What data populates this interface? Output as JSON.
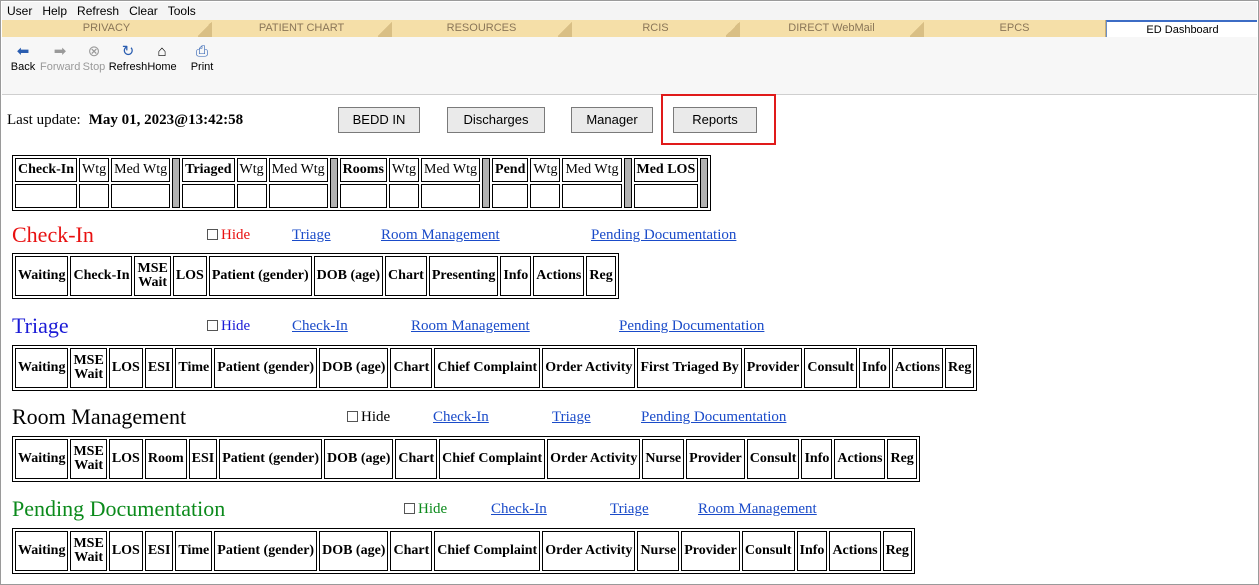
{
  "menu": [
    "User",
    "Help",
    "Refresh",
    "Clear",
    "Tools"
  ],
  "tabs": [
    "PRIVACY",
    "PATIENT CHART",
    "RESOURCES",
    "RCIS",
    "DIRECT WebMail",
    "EPCS",
    "ED Dashboard"
  ],
  "toolbar": {
    "back": "Back",
    "forward": "Forward",
    "stop": "Stop",
    "refresh": "Refresh",
    "home": "Home",
    "print": "Print"
  },
  "update": {
    "label": "Last update:",
    "value": "May 01, 2023@13:42:58"
  },
  "buttons": {
    "bedd_in": "BEDD IN",
    "discharges": "Discharges",
    "manager": "Manager",
    "reports": "Reports"
  },
  "summary": {
    "headers": [
      "Check-In",
      "Wtg",
      "Med Wtg",
      "Triaged",
      "Wtg",
      "Med Wtg",
      "Rooms",
      "Wtg",
      "Med Wtg",
      "Pend",
      "Wtg",
      "Med Wtg",
      "Med LOS"
    ]
  },
  "hide_label": "Hide",
  "sections": {
    "checkin": {
      "title": "Check-In",
      "color": "#e81010",
      "links": [
        "Triage",
        "Room Management",
        "Pending Documentation"
      ],
      "columns": [
        "Waiting",
        "Check-In",
        "MSE",
        "Wait",
        "LOS",
        "Patient (gender)",
        "DOB (age)",
        "Chart",
        "Presenting",
        "Info",
        "Actions",
        "Reg"
      ]
    },
    "triage": {
      "title": "Triage",
      "color": "#1a1ad6",
      "links": [
        "Check-In",
        "Room Management",
        "Pending Documentation"
      ],
      "columns": [
        "Waiting",
        "MSE",
        "Wait",
        "LOS",
        "ESI",
        "Time",
        "Patient (gender)",
        "DOB (age)",
        "Chart",
        "Chief Complaint",
        "Order Activity",
        "First Triaged By",
        "Provider",
        "Consult",
        "Info",
        "Actions",
        "Reg"
      ]
    },
    "room": {
      "title": "Room Management",
      "color": "#000000",
      "links": [
        "Check-In",
        "Triage",
        "Pending Documentation"
      ],
      "columns": [
        "Waiting",
        "MSE",
        "Wait",
        "LOS",
        "Room",
        "ESI",
        "Patient (gender)",
        "DOB (age)",
        "Chart",
        "Chief Complaint",
        "Order Activity",
        "Nurse",
        "Provider",
        "Consult",
        "Info",
        "Actions",
        "Reg"
      ]
    },
    "pending": {
      "title": "Pending Documentation",
      "color": "#0b8a1b",
      "links": [
        "Check-In",
        "Triage",
        "Room Management"
      ],
      "columns": [
        "Waiting",
        "MSE",
        "Wait",
        "LOS",
        "ESI",
        "Time",
        "Patient (gender)",
        "DOB (age)",
        "Chart",
        "Chief Complaint",
        "Order Activity",
        "Nurse",
        "Provider",
        "Consult",
        "Info",
        "Actions",
        "Reg"
      ]
    }
  }
}
